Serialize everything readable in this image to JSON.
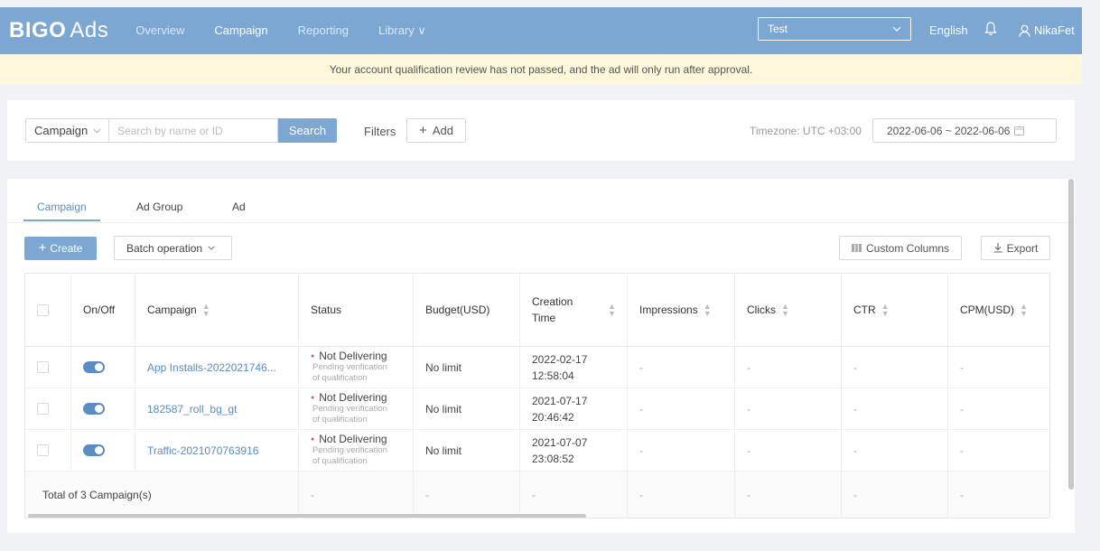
{
  "brand": {
    "logo_main": "BIGO",
    "logo_sub": "Ads"
  },
  "nav": [
    {
      "label": "Overview"
    },
    {
      "label": "Campaign"
    },
    {
      "label": "Reporting"
    },
    {
      "label": "Library ∨"
    }
  ],
  "account_select": {
    "value": "Test"
  },
  "language": "English",
  "user": {
    "name": "NikaFet"
  },
  "notice": "Your account qualification review has not passed, and the ad will only run after approval.",
  "filterbar": {
    "search_type": "Campaign",
    "search_placeholder": "Search by name or ID",
    "search_button": "Search",
    "filters_label": "Filters",
    "add_button": "Add",
    "timezone": "Timezone: UTC +03:00",
    "date_range": "2022-06-06 ~ 2022-06-06"
  },
  "tabs": [
    {
      "label": "Campaign"
    },
    {
      "label": "Ad Group"
    },
    {
      "label": "Ad"
    }
  ],
  "toolbar": {
    "create": "Create",
    "batch": "Batch operation",
    "custom_columns": "Custom Columns",
    "export": "Export"
  },
  "columns": [
    "On/Off",
    "Campaign",
    "Status",
    "Budget(USD)",
    "Creation Time",
    "Impressions",
    "Clicks",
    "CTR",
    "CPM(USD)"
  ],
  "rows": [
    {
      "name": "App Installs-2022021746...",
      "status": "Not Delivering",
      "status_sub1": "Pending verification",
      "status_sub2": "of qualification",
      "budget": "No limit",
      "date": "2022-02-17",
      "time": "12:58:04",
      "impressions": "-",
      "clicks": "-",
      "ctr": "-",
      "cpm": "-"
    },
    {
      "name": "182587_roll_bg_gt",
      "status": "Not Delivering",
      "status_sub1": "Pending verification",
      "status_sub2": "of qualification",
      "budget": "No limit",
      "date": "2021-07-17",
      "time": "20:46:42",
      "impressions": "-",
      "clicks": "-",
      "ctr": "-",
      "cpm": "-"
    },
    {
      "name": "Traffic-2021070763916",
      "status": "Not Delivering",
      "status_sub1": "Pending verification",
      "status_sub2": "of qualification",
      "budget": "No limit",
      "date": "2021-07-07",
      "time": "23:08:52",
      "impressions": "-",
      "clicks": "-",
      "ctr": "-",
      "cpm": "-"
    }
  ],
  "footer": {
    "total": "Total of 3 Campaign(s)",
    "dash": "-"
  }
}
